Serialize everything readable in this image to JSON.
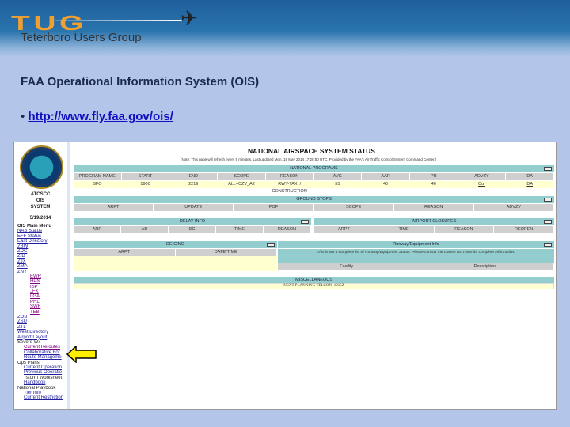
{
  "banner": {
    "logo": "TUG",
    "subtitle": "Teterboro Users Group"
  },
  "slide": {
    "title": "FAA Operational Information System (OIS)",
    "bullet": "•",
    "link": "http://www.fly.faa.gov/ois/"
  },
  "sidebar": {
    "title1": "ATCSCC",
    "title2": "OIS",
    "title3": "SYSTEM",
    "date": "5/19/2014",
    "items": [
      "OIS Main Menu",
      "NAS Status",
      "EFF Status",
      "East Directory",
      "ZBW",
      "ZDC",
      "ZID",
      "ZJX",
      "ZMA",
      "ZNY",
      "EWR",
      "HPN",
      "ISP",
      "JFK",
      "LGA",
      "PHL",
      "SWF",
      "TEB",
      "ZOB",
      "ZSU",
      "ZTL",
      "West Directory",
      "Airport Layout",
      "Severe Wx",
      "Current Reroutes",
      "Collaborative For",
      "Route Manageme",
      "Ops Plans",
      "Current Operation",
      "Previous Operatio",
      "Tstorm Worksheet",
      "Handbook",
      "National Playbook",
      "Tier Info",
      "Current Restriction"
    ]
  },
  "page": {
    "title": "NATIONAL AIRSPACE SYSTEM STATUS",
    "note": "(Note: This page will refresh every 5 minutes.  Last updated Mon. 19 May 2014 17:28:50 UTC.  Provided by the FAA's Air Traffic Control System Command Center.)",
    "national_programs": {
      "header": "NATIONAL PROGRAMS",
      "columns": [
        "PROGRAM NAME",
        "START",
        "END",
        "SCOPE",
        "REASON",
        "AVG",
        "AAR",
        "PR",
        "ADVZY",
        "DA"
      ],
      "rows": [
        [
          "SFO",
          "1900",
          "2219",
          "ALL+CZV_A2",
          "RWY-TAXI / CONSTRUCTION",
          "55",
          "40",
          "40",
          "Cur",
          "DA"
        ]
      ]
    },
    "ground_stops": {
      "header": "GROUND STOPS",
      "columns": [
        "ARPT",
        "UPDATE",
        "POF",
        "SCOPE",
        "REASON",
        "ADVZY"
      ]
    },
    "delay_info": {
      "header": "DELAY INFO",
      "columns": [
        "ARR",
        "AD",
        "DC",
        "TIME",
        "REASON"
      ]
    },
    "airport_closures": {
      "header": "AIRPORT CLOSURES",
      "columns": [
        "ARPT",
        "TIME",
        "REASON",
        "REOPEN"
      ]
    },
    "deicing": {
      "header": "DEICING",
      "columns": [
        "ARPT",
        "DATE/TIME"
      ]
    },
    "runway": {
      "header": "Runway/Equipment Info",
      "note": "This is not a complete list of Runway/Equipment Status. Please consult the current NOTAMs for complete information.",
      "columns": [
        "Facility",
        "Description"
      ]
    },
    "misc": {
      "header": "MISCELLANEOUS",
      "text": "NEXT PLANNING TELCON: 1915Z"
    }
  },
  "colors": {
    "bar": "#93cdcd",
    "row": "#ffffd0",
    "arrow": "#ffee00"
  }
}
